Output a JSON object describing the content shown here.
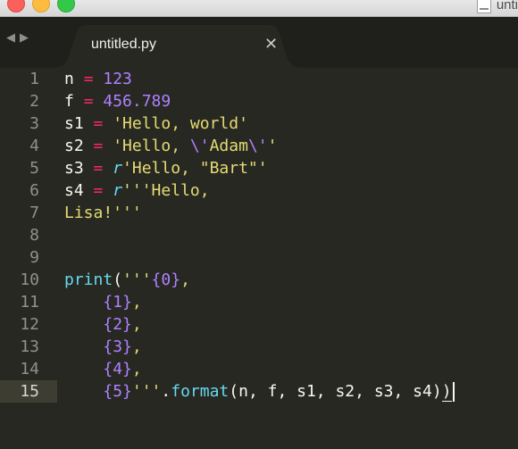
{
  "window": {
    "title": "unti"
  },
  "nav": {
    "back": "◀",
    "forward": "▶"
  },
  "tab": {
    "label": "untitled.py",
    "close": "✕"
  },
  "editor": {
    "active_line": 15,
    "lines": [
      {
        "num": "1",
        "tokens": [
          {
            "t": "n ",
            "c": ""
          },
          {
            "t": "=",
            "c": "k"
          },
          {
            "t": " ",
            "c": ""
          },
          {
            "t": "123",
            "c": "n"
          }
        ]
      },
      {
        "num": "2",
        "tokens": [
          {
            "t": "f ",
            "c": ""
          },
          {
            "t": "=",
            "c": "k"
          },
          {
            "t": " ",
            "c": ""
          },
          {
            "t": "456.789",
            "c": "n"
          }
        ]
      },
      {
        "num": "3",
        "tokens": [
          {
            "t": "s1 ",
            "c": ""
          },
          {
            "t": "=",
            "c": "k"
          },
          {
            "t": " ",
            "c": ""
          },
          {
            "t": "'Hello, world'",
            "c": "s"
          }
        ]
      },
      {
        "num": "4",
        "tokens": [
          {
            "t": "s2 ",
            "c": ""
          },
          {
            "t": "=",
            "c": "k"
          },
          {
            "t": " ",
            "c": ""
          },
          {
            "t": "'Hello, ",
            "c": "s"
          },
          {
            "t": "\\'",
            "c": "n"
          },
          {
            "t": "Adam",
            "c": "s"
          },
          {
            "t": "\\'",
            "c": "n"
          },
          {
            "t": "'",
            "c": "s"
          }
        ]
      },
      {
        "num": "5",
        "tokens": [
          {
            "t": "s3 ",
            "c": ""
          },
          {
            "t": "=",
            "c": "k"
          },
          {
            "t": " ",
            "c": ""
          },
          {
            "t": "r",
            "c": "ri"
          },
          {
            "t": "'Hello, \"Bart\"'",
            "c": "s"
          }
        ]
      },
      {
        "num": "6",
        "tokens": [
          {
            "t": "s4 ",
            "c": ""
          },
          {
            "t": "=",
            "c": "k"
          },
          {
            "t": " ",
            "c": ""
          },
          {
            "t": "r",
            "c": "ri"
          },
          {
            "t": "'''Hello,",
            "c": "s"
          }
        ]
      },
      {
        "num": "7",
        "tokens": [
          {
            "t": "Lisa!'''",
            "c": "s"
          }
        ]
      },
      {
        "num": "8",
        "tokens": []
      },
      {
        "num": "9",
        "tokens": []
      },
      {
        "num": "10",
        "tokens": [
          {
            "t": "print",
            "c": "f"
          },
          {
            "t": "(",
            "c": ""
          },
          {
            "t": "'''",
            "c": "s"
          },
          {
            "t": "{0}",
            "c": "n"
          },
          {
            "t": ",",
            "c": "s"
          }
        ]
      },
      {
        "num": "11",
        "tokens": [
          {
            "t": "    ",
            "c": ""
          },
          {
            "t": "{1}",
            "c": "n"
          },
          {
            "t": ",",
            "c": "s"
          }
        ]
      },
      {
        "num": "12",
        "tokens": [
          {
            "t": "    ",
            "c": ""
          },
          {
            "t": "{2}",
            "c": "n"
          },
          {
            "t": ",",
            "c": "s"
          }
        ]
      },
      {
        "num": "13",
        "tokens": [
          {
            "t": "    ",
            "c": ""
          },
          {
            "t": "{3}",
            "c": "n"
          },
          {
            "t": ",",
            "c": "s"
          }
        ]
      },
      {
        "num": "14",
        "tokens": [
          {
            "t": "    ",
            "c": ""
          },
          {
            "t": "{4}",
            "c": "n"
          },
          {
            "t": ",",
            "c": "s"
          }
        ]
      },
      {
        "num": "15",
        "tokens": [
          {
            "t": "    ",
            "c": ""
          },
          {
            "t": "{5}",
            "c": "n"
          },
          {
            "t": "'''",
            "c": "s"
          },
          {
            "t": ".",
            "c": ""
          },
          {
            "t": "format",
            "c": "f"
          },
          {
            "t": "(n, f, s1, s2, s3, s4)",
            "c": ""
          },
          {
            "t": ")",
            "c": "ul"
          }
        ]
      }
    ]
  },
  "colors": {
    "background": "#272822",
    "keyword": "#f92672",
    "number": "#ae81ff",
    "string": "#e6db74",
    "function": "#66d9ef",
    "text": "#f8f8f2"
  }
}
